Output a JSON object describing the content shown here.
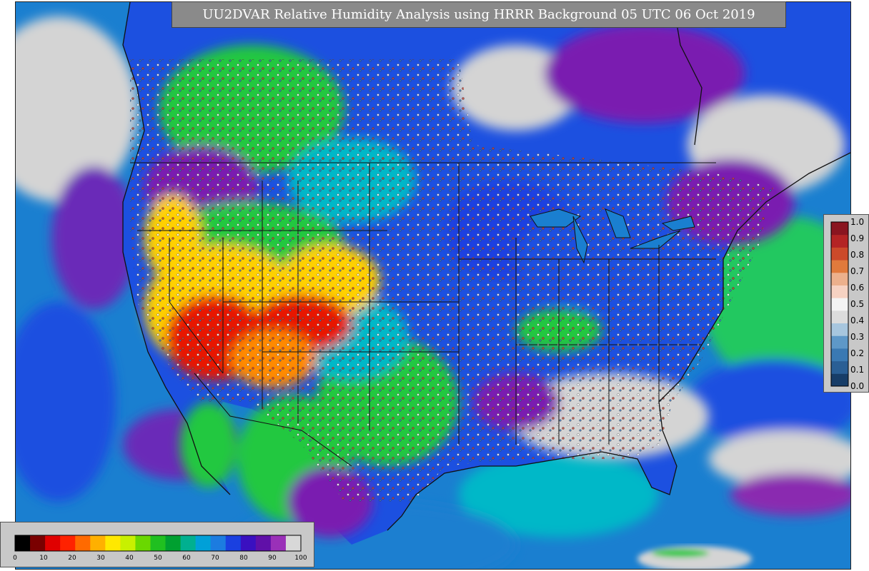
{
  "title": "UU2DVAR Relative Humidity Analysis using HRRR Background 05 UTC 06 Oct 2019",
  "rh_colorbar": {
    "ticks": [
      "0",
      "10",
      "20",
      "30",
      "40",
      "50",
      "60",
      "70",
      "80",
      "90",
      "100"
    ],
    "colors": [
      "#000000",
      "#7a0000",
      "#e00000",
      "#ff2200",
      "#ff6a00",
      "#ffb000",
      "#ffe800",
      "#c8f000",
      "#6ad800",
      "#20c020",
      "#00a030",
      "#00b090",
      "#00a0d8",
      "#1c7ce0",
      "#1a40e0",
      "#3a10c0",
      "#6010a8",
      "#9a30b8",
      "#d8d8d8"
    ]
  },
  "obs_colorbar": {
    "ticks": [
      "0.0",
      "0.1",
      "0.2",
      "0.3",
      "0.4",
      "0.5",
      "0.6",
      "0.7",
      "0.8",
      "0.9",
      "1.0"
    ],
    "colors": [
      "#173d68",
      "#2a5f95",
      "#3a79b3",
      "#5e98c8",
      "#a7c6de",
      "#dcdcdc",
      "#f4f4f4",
      "#f6d2c2",
      "#ecb08c",
      "#e07a3c",
      "#cc4a2a",
      "#b42424",
      "#8a1520"
    ]
  },
  "map_colors": {
    "ocean": "#1a7fd0",
    "land": "#1c50e0",
    "very_moist": "#d4d4d4",
    "moist": "#7a1ab0",
    "moderate": "#00b8c8",
    "dry": "#20c840",
    "drier": "#ffd000",
    "driest": "#e81800",
    "borders": "#111111"
  }
}
